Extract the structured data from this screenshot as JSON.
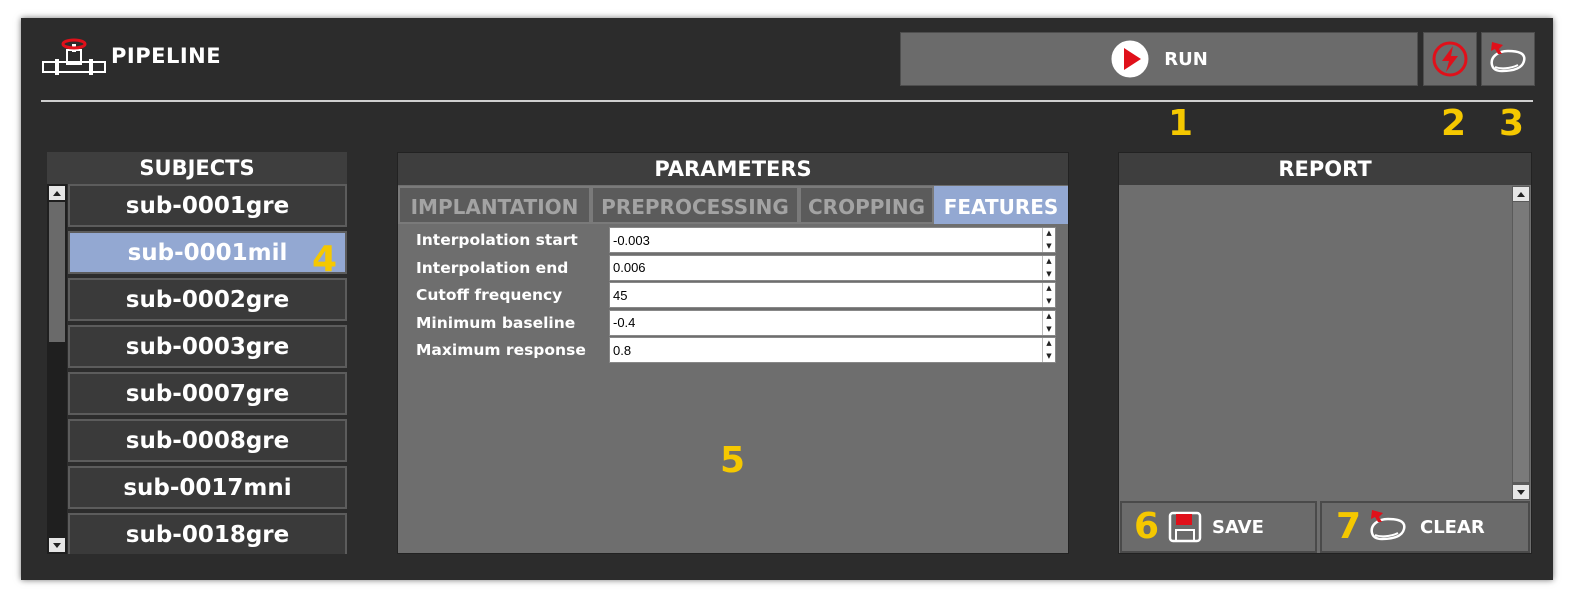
{
  "header": {
    "title": "PIPELINE",
    "run_label": "RUN",
    "icons": {
      "app": "pipeline-valve-icon",
      "run": "play-icon",
      "quick": "lightning-icon",
      "clear_all": "eraser-icon"
    }
  },
  "callouts": {
    "c1": "1",
    "c2": "2",
    "c3": "3",
    "c4": "4",
    "c5": "5",
    "c6": "6",
    "c7": "7"
  },
  "subjects": {
    "title": "SUBJECTS",
    "items": [
      "sub-0001gre",
      "sub-0001mil",
      "sub-0002gre",
      "sub-0003gre",
      "sub-0007gre",
      "sub-0008gre",
      "sub-0017mni",
      "sub-0018gre"
    ],
    "selected": "sub-0001mil"
  },
  "parameters": {
    "title": "PARAMETERS",
    "tabs": [
      "IMPLANTATION",
      "PREPROCESSING",
      "CROPPING",
      "FEATURES"
    ],
    "active_tab": "FEATURES",
    "fields": [
      {
        "label": "Interpolation start",
        "value": "-0.003"
      },
      {
        "label": "Interpolation end",
        "value": "0.006"
      },
      {
        "label": "Cutoff frequency",
        "value": "45"
      },
      {
        "label": "Minimum baseline",
        "value": "-0.4"
      },
      {
        "label": "Maximum response",
        "value": "0.8"
      }
    ]
  },
  "report": {
    "title": "REPORT",
    "save_label": "SAVE",
    "clear_label": "CLEAR"
  },
  "colors": {
    "background": "#2c2c2c",
    "selected": "#93a8d2",
    "accent_red": "#e0101a",
    "callout": "#f5c800"
  }
}
